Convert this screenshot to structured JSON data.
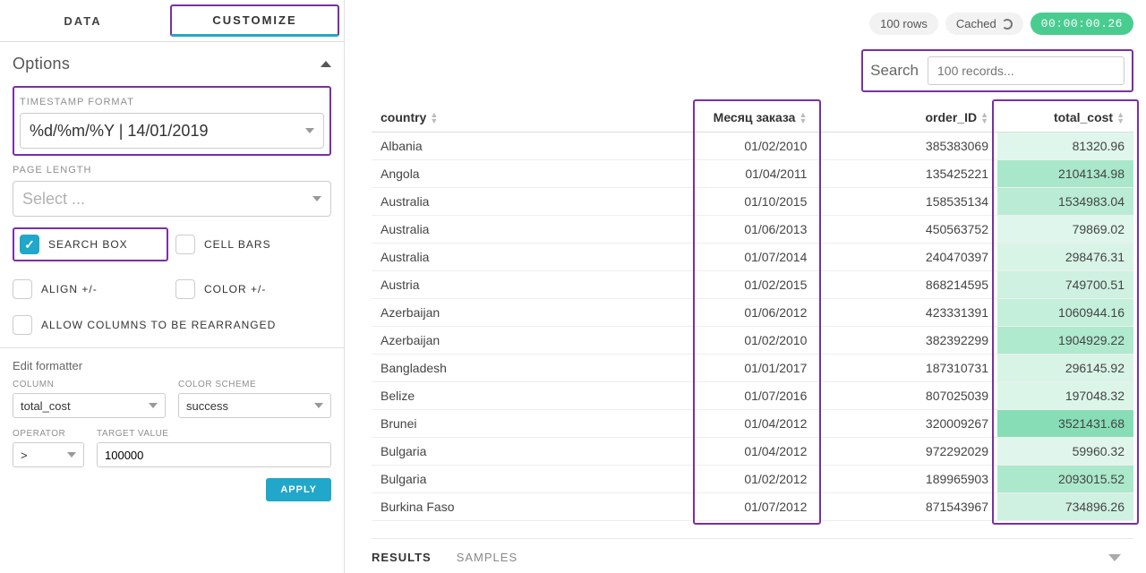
{
  "tabs": {
    "data": "DATA",
    "customize": "CUSTOMIZE"
  },
  "options": {
    "title": "Options",
    "timestamp_label": "TIMESTAMP FORMAT",
    "timestamp_value": "%d/%m/%Y  |  14/01/2019",
    "pagelen_label": "PAGE LENGTH",
    "pagelen_placeholder": "Select ...",
    "checks": {
      "search": "SEARCH BOX",
      "cellbars": "CELL BARS",
      "align": "ALIGN +/-",
      "color": "COLOR +/-",
      "rearrange": "ALLOW COLUMNS TO BE REARRANGED"
    }
  },
  "formatter": {
    "title": "Edit formatter",
    "column_label": "COLUMN",
    "column_value": "total_cost",
    "scheme_label": "COLOR SCHEME",
    "scheme_value": "success",
    "operator_label": "OPERATOR",
    "operator_value": ">",
    "target_label": "TARGET VALUE",
    "target_value": "100000",
    "apply": "APPLY"
  },
  "topbar": {
    "rows": "100 rows",
    "cached": "Cached",
    "timer": "00:00:00.26"
  },
  "search": {
    "label": "Search",
    "placeholder": "100 records..."
  },
  "table": {
    "headers": {
      "country": "country",
      "month": "Месяц заказа",
      "order": "order_ID",
      "total": "total_cost"
    },
    "rows": [
      {
        "country": "Albania",
        "month": "01/02/2010",
        "order": "385383069",
        "total": "81320.96",
        "shade": 0.06
      },
      {
        "country": "Angola",
        "month": "01/04/2011",
        "order": "135425221",
        "total": "2104134.98",
        "shade": 0.58
      },
      {
        "country": "Australia",
        "month": "01/10/2015",
        "order": "158535134",
        "total": "1534983.04",
        "shade": 0.42
      },
      {
        "country": "Australia",
        "month": "01/06/2013",
        "order": "450563752",
        "total": "79869.02",
        "shade": 0.05
      },
      {
        "country": "Australia",
        "month": "01/07/2014",
        "order": "240470397",
        "total": "298476.31",
        "shade": 0.11
      },
      {
        "country": "Austria",
        "month": "01/02/2015",
        "order": "868214595",
        "total": "749700.51",
        "shade": 0.22
      },
      {
        "country": "Azerbaijan",
        "month": "01/06/2012",
        "order": "423331391",
        "total": "1060944.16",
        "shade": 0.3
      },
      {
        "country": "Azerbaijan",
        "month": "01/02/2010",
        "order": "382392299",
        "total": "1904929.22",
        "shade": 0.52
      },
      {
        "country": "Bangladesh",
        "month": "01/01/2017",
        "order": "187310731",
        "total": "296145.92",
        "shade": 0.11
      },
      {
        "country": "Belize",
        "month": "01/07/2016",
        "order": "807025039",
        "total": "197048.32",
        "shade": 0.09
      },
      {
        "country": "Brunei",
        "month": "01/04/2012",
        "order": "320009267",
        "total": "3521431.68",
        "shade": 0.92
      },
      {
        "country": "Bulgaria",
        "month": "01/04/2012",
        "order": "972292029",
        "total": "59960.32",
        "shade": 0.04
      },
      {
        "country": "Bulgaria",
        "month": "01/02/2012",
        "order": "189965903",
        "total": "2093015.52",
        "shade": 0.56
      },
      {
        "country": "Burkina Faso",
        "month": "01/07/2012",
        "order": "871543967",
        "total": "734896.26",
        "shade": 0.21
      }
    ]
  },
  "bottom": {
    "results": "RESULTS",
    "samples": "SAMPLES"
  }
}
